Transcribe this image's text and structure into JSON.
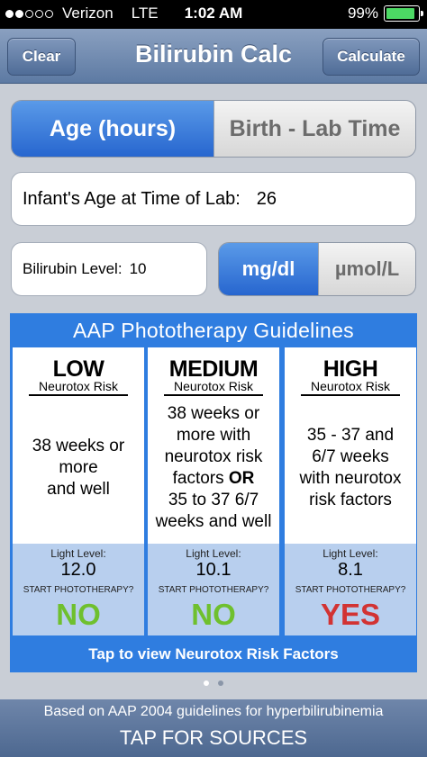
{
  "status": {
    "carrier": "Verizon",
    "network": "LTE",
    "time": "1:02 AM",
    "battery": "99%",
    "signal_bars": 2,
    "signal_total": 5
  },
  "nav": {
    "title": "Bilirubin Calc",
    "clear_label": "Clear",
    "calculate_label": "Calculate"
  },
  "mode_segment": {
    "selected": "Age (hours)",
    "other": "Birth - Lab Time"
  },
  "age_field": {
    "label": "Infant's Age at Time of Lab:",
    "value": "26"
  },
  "bili_field": {
    "label": "Bilirubin Level:",
    "value": "10"
  },
  "unit_segment": {
    "selected": "mg/dl",
    "other": "µmol/L"
  },
  "guidelines": {
    "heading": "AAP Phototherapy Guidelines",
    "columns": [
      {
        "risk": "LOW",
        "subtitle": "Neurotox Risk",
        "desc_lines": [
          "38 weeks or",
          "more",
          "and well"
        ],
        "light_label": "Light Level:",
        "light_value": "12.0",
        "start_label": "START PHOTOTHERAPY?",
        "answer": "NO"
      },
      {
        "risk": "MEDIUM",
        "subtitle": "Neurotox Risk",
        "desc_lines": [
          "38 weeks or",
          "more with",
          "neurotox risk",
          "factors",
          "OR",
          "35 to 37 6/7",
          "weeks and well"
        ],
        "light_label": "Light Level:",
        "light_value": "10.1",
        "start_label": "START PHOTOTHERAPY?",
        "answer": "NO"
      },
      {
        "risk": "HIGH",
        "subtitle": "Neurotox Risk",
        "desc_lines": [
          "35 - 37 and",
          "6/7 weeks",
          "with neurotox",
          "risk factors"
        ],
        "light_label": "Light Level:",
        "light_value": "8.1",
        "start_label": "START PHOTOTHERAPY?",
        "answer": "YES"
      }
    ],
    "tap_label": "Tap to view Neurotox Risk Factors"
  },
  "pager": {
    "pages": 2,
    "current": 1
  },
  "footer": {
    "line1": "Based on AAP 2004 guidelines for hyperbilirubinemia",
    "line2": "TAP FOR SOURCES"
  },
  "colors": {
    "accent_blue": "#2f7de0",
    "no_green": "#6fc02e",
    "yes_red": "#d23333"
  }
}
